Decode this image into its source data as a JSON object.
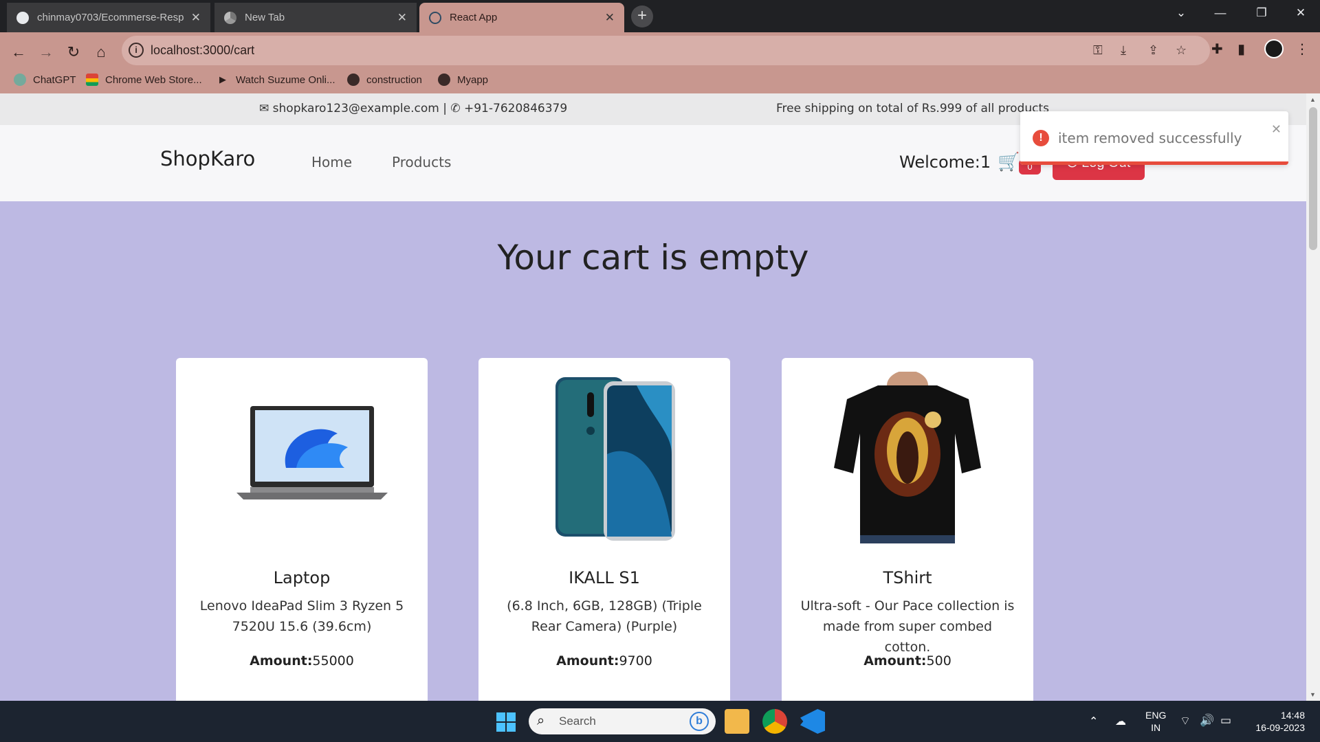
{
  "browser": {
    "tabs": [
      {
        "title": "chinmay0703/Ecommerse-Resp",
        "active": false,
        "icon": "github-icon"
      },
      {
        "title": "New Tab",
        "active": false,
        "icon": "chrome-icon"
      },
      {
        "title": "React App",
        "active": true,
        "icon": "react-icon"
      }
    ],
    "url": "localhost:3000/cart",
    "bookmarks": [
      {
        "label": "ChatGPT",
        "icon": "chatgpt-icon"
      },
      {
        "label": "Chrome Web Store...",
        "icon": "webstore-icon"
      },
      {
        "label": "Watch Suzume Onli...",
        "icon": "play-icon"
      },
      {
        "label": "construction",
        "icon": "globe-icon"
      },
      {
        "label": "Myapp",
        "icon": "globe-icon"
      }
    ],
    "colors": {
      "theme": "#c8978f",
      "tabbar": "#202124"
    }
  },
  "topbar": {
    "email": "shopkaro123@example.com",
    "separator": "|",
    "phone": "+91-7620846379",
    "shipping": "Free shipping on total of Rs.999 of all products"
  },
  "navbar": {
    "brand": "ShopKaro",
    "links": [
      "Home",
      "Products"
    ],
    "welcome": "Welcome:1",
    "cart_count": "0",
    "logout": "Log Out"
  },
  "main": {
    "heading": "Your cart is empty",
    "products": [
      {
        "title": "Laptop",
        "description": "Lenovo IdeaPad Slim 3 Ryzen 5 7520U 15.6 (39.6cm)",
        "amount_label": "Amount:",
        "amount": "55000"
      },
      {
        "title": "IKALL S1",
        "description": "(6.8 Inch, 6GB, 128GB) (Triple Rear Camera) (Purple)",
        "amount_label": "Amount:",
        "amount": "9700"
      },
      {
        "title": "TShirt",
        "description": "Ultra-soft - Our Pace collection is made from super combed cotton.",
        "amount_label": "Amount:",
        "amount": "500"
      }
    ]
  },
  "toast": {
    "message": "item removed successfully",
    "type": "error",
    "color": "#e74c3c"
  },
  "taskbar": {
    "search_placeholder": "Search",
    "language": "ENG",
    "region": "IN",
    "time": "14:48",
    "date": "16-09-2023"
  }
}
